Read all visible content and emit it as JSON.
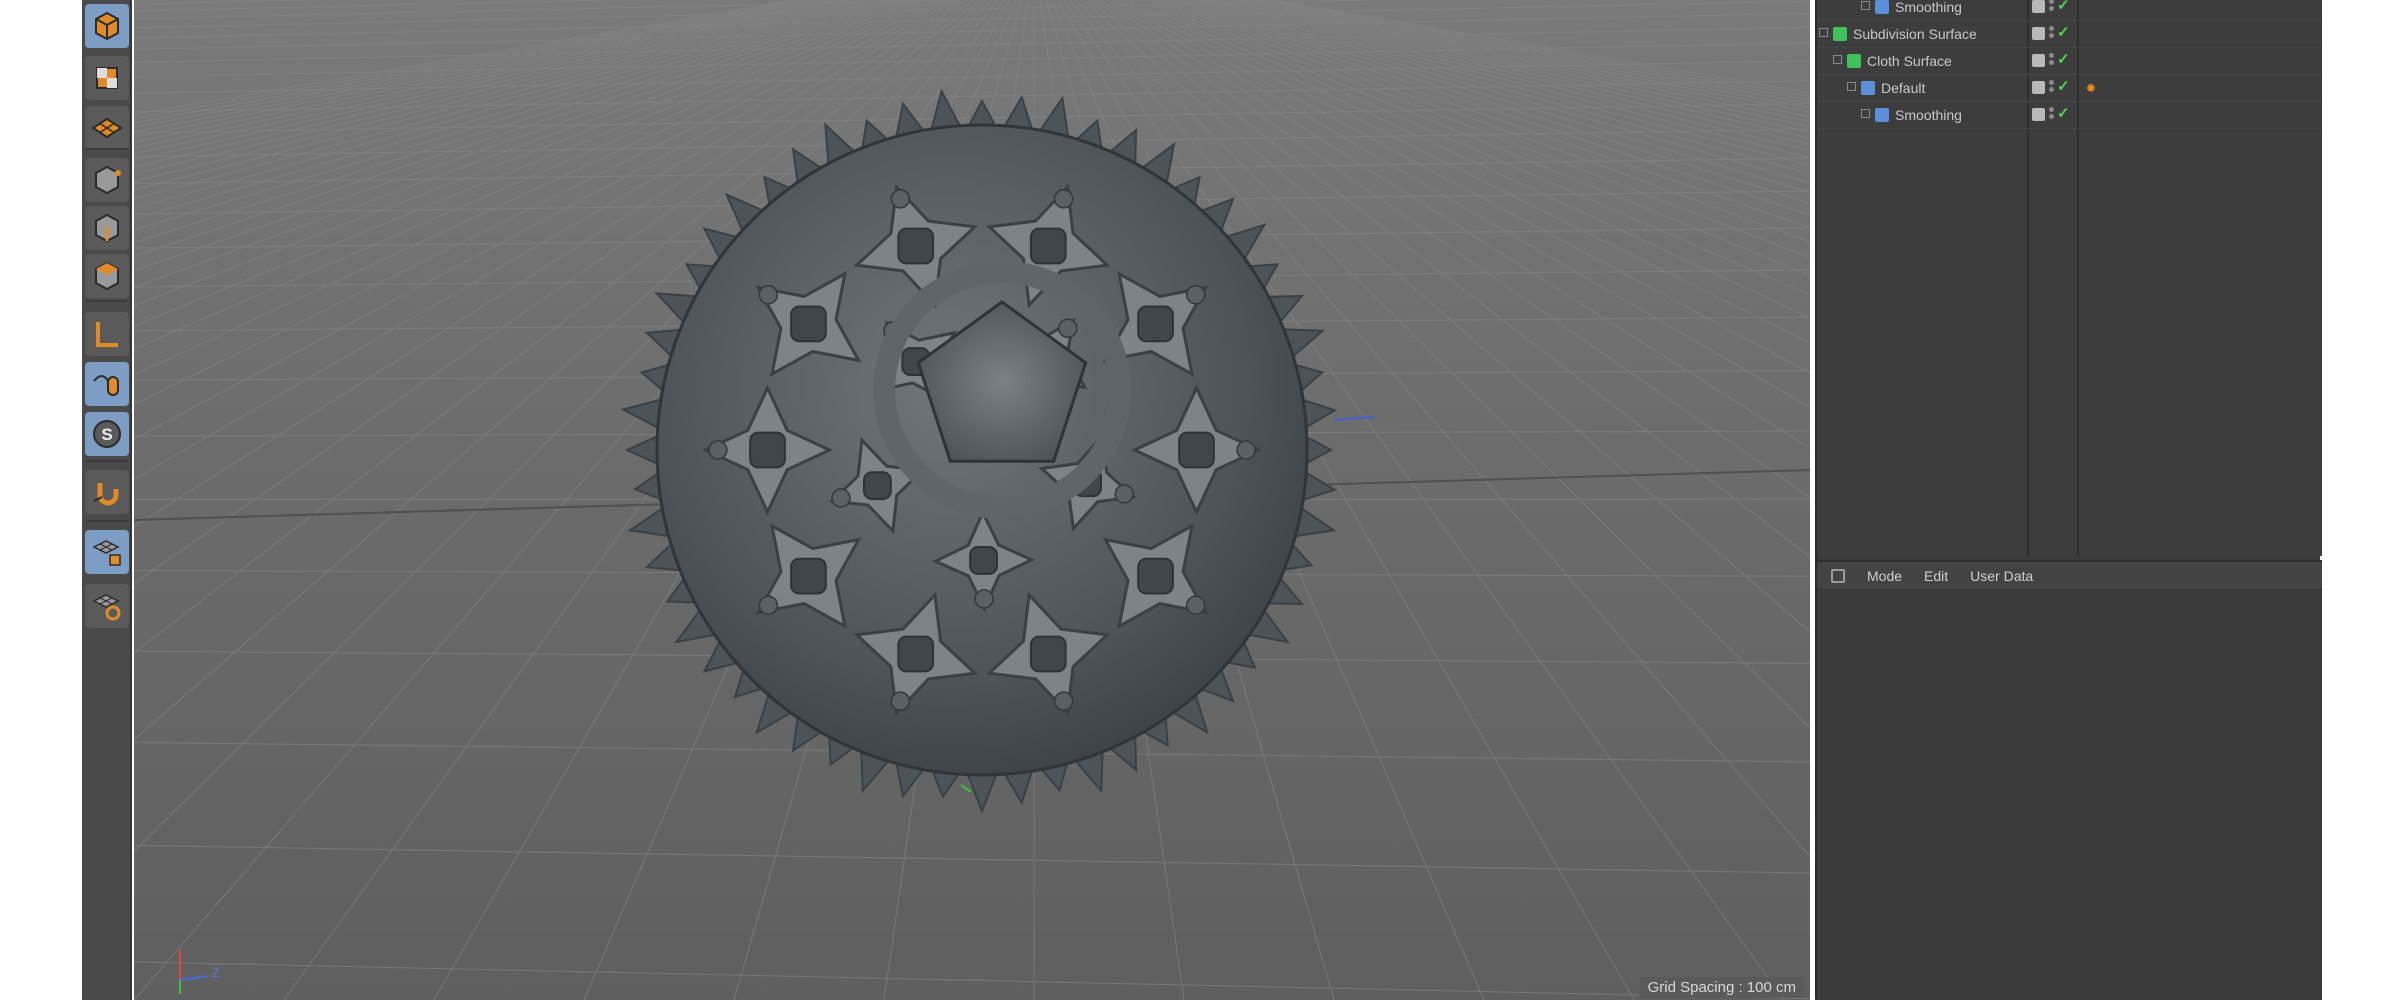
{
  "palette": {
    "tools": [
      {
        "name": "model-mode-icon",
        "active": true
      },
      {
        "name": "texture-mode-icon",
        "active": false
      },
      {
        "name": "workplane-mode-icon",
        "active": false
      },
      {
        "name": "points-mode-icon",
        "active": false
      },
      {
        "name": "edges-mode-icon",
        "active": false
      },
      {
        "name": "polygons-mode-icon",
        "active": false
      },
      {
        "name": "axis-mode-icon",
        "active": false
      },
      {
        "name": "tweak-mode-icon",
        "active": true
      },
      {
        "name": "solo-mode-icon",
        "active": true
      },
      {
        "name": "snap-icon",
        "active": false
      },
      {
        "name": "workplane-lock-icon",
        "active": true
      },
      {
        "name": "workplane-icon",
        "active": false
      }
    ]
  },
  "viewport": {
    "grid_spacing": "Grid Spacing : 100 cm",
    "axis_labels": {
      "x": "",
      "y": "",
      "z": "Z"
    }
  },
  "object_manager": {
    "rows": [
      {
        "name": "Smoothing",
        "depth": 3,
        "icon": "smoothing-tag-icon",
        "icon_color": "#5b8fd9",
        "has_tag": false
      },
      {
        "name": "Subdivision Surface",
        "depth": 0,
        "icon": "subdivision-surface-icon",
        "icon_color": "#3fc25a",
        "has_tag": false
      },
      {
        "name": "Cloth Surface",
        "depth": 1,
        "icon": "cloth-surface-icon",
        "icon_color": "#3fc25a",
        "has_tag": false
      },
      {
        "name": "Default",
        "depth": 2,
        "icon": "polygon-object-icon",
        "icon_color": "#5b8fd9",
        "has_tag": true
      },
      {
        "name": "Smoothing",
        "depth": 3,
        "icon": "smoothing-tag-icon",
        "icon_color": "#5b8fd9",
        "has_tag": false
      }
    ]
  },
  "attribute_manager": {
    "menu": [
      "Mode",
      "Edit",
      "User Data"
    ]
  },
  "colors": {
    "accent_orange": "#f08a1c",
    "active_tool_blue": "#7d9dc4",
    "check_green": "#4fd34f"
  }
}
